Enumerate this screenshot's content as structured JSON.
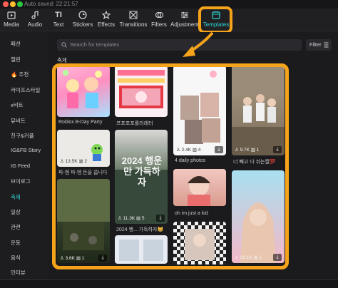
{
  "titlebar": {
    "autosave": "Auto saved: 22:21:57"
  },
  "toolbar": {
    "items": [
      {
        "label": "Media",
        "icon": "media-icon"
      },
      {
        "label": "Audio",
        "icon": "audio-icon"
      },
      {
        "label": "Text",
        "icon": "text-icon"
      },
      {
        "label": "Stickers",
        "icon": "stickers-icon"
      },
      {
        "label": "Effects",
        "icon": "effects-icon"
      },
      {
        "label": "Transitions",
        "icon": "transitions-icon"
      },
      {
        "label": "Filters",
        "icon": "filters-icon"
      },
      {
        "label": "Adjustment",
        "icon": "adjustment-icon"
      },
      {
        "label": "Templates",
        "icon": "templates-icon",
        "active": true
      }
    ]
  },
  "sidebar": {
    "items": [
      {
        "label": "패션"
      },
      {
        "label": "챌린"
      },
      {
        "label": "🔥 추천"
      },
      {
        "label": "라이프스타일"
      },
      {
        "label": "x비트"
      },
      {
        "label": "뮤비트"
      },
      {
        "label": "친구&커플"
      },
      {
        "label": "IG&FB Story"
      },
      {
        "label": "IG Feed"
      },
      {
        "label": "브이로그"
      },
      {
        "label": "축제",
        "active": true
      },
      {
        "label": "일상"
      },
      {
        "label": "관련"
      },
      {
        "label": "운동"
      },
      {
        "label": "음식"
      },
      {
        "label": "인터뷰"
      }
    ]
  },
  "search": {
    "placeholder": "Search for templates"
  },
  "filter": {
    "label": "Filter"
  },
  "section": {
    "title": "축제"
  },
  "templates": [
    {
      "title": "Roblox B-Day Party",
      "uses": "13.5K",
      "clips": "2"
    },
    {
      "title": "파-엠 파-엠 돈을 씁니다",
      "uses": "3.6K",
      "clips": "1"
    },
    {
      "title": "프포포포롤러레터",
      "uses": "11.3K",
      "clips": "5"
    },
    {
      "title": "2024 행... 가득하자😸",
      "overlay": "2024 행운만 가득하자"
    },
    {
      "title": "4 daily photos",
      "uses": "2.4K",
      "clips": "4"
    },
    {
      "title": "oh im just a kid",
      "uses": "",
      "clips": ""
    },
    {
      "title": "너 빼고 다 쉬는짤💯",
      "uses": "9.7K",
      "clips": "1"
    },
    {
      "title": "",
      "uses": "28.1K",
      "clips": "1"
    }
  ],
  "colors": {
    "accent": "#2fd4d0",
    "highlight": "#f5a31a"
  }
}
